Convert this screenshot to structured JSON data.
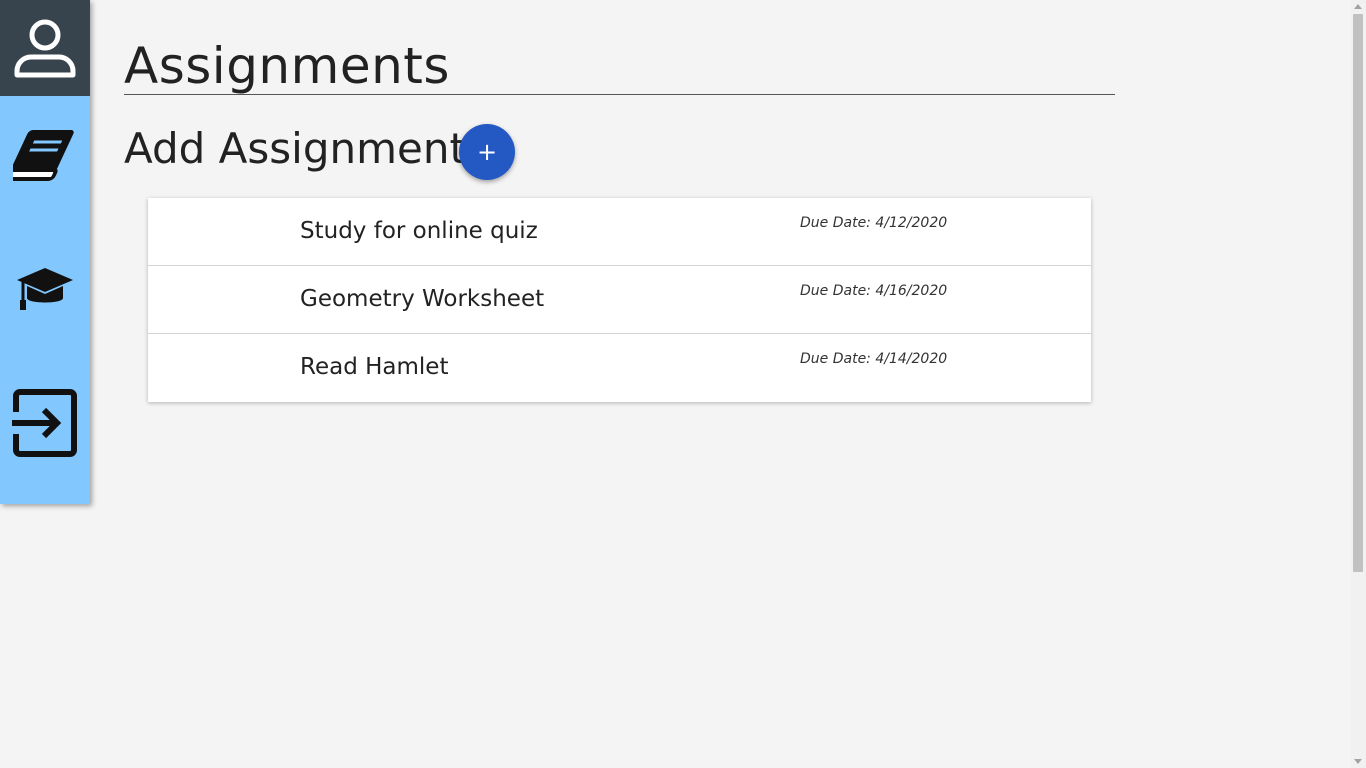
{
  "sidebar": {
    "items": [
      {
        "name": "profile",
        "icon": "user-icon"
      },
      {
        "name": "assignments",
        "icon": "book-icon"
      },
      {
        "name": "grades",
        "icon": "graduation-cap-icon"
      },
      {
        "name": "logout",
        "icon": "logout-icon"
      }
    ],
    "colors": {
      "background": "#82c8ff",
      "profile_background": "#37434d"
    }
  },
  "main": {
    "title": "Assignments",
    "add_heading": "Add Assignment",
    "add_button_label": "+",
    "accent": "#2459c4"
  },
  "assignments": [
    {
      "title": "Study for online quiz",
      "due": "Due Date: 4/12/2020"
    },
    {
      "title": "Geometry Worksheet",
      "due": "Due Date: 4/16/2020"
    },
    {
      "title": "Read Hamlet",
      "due": "Due Date: 4/14/2020"
    }
  ]
}
